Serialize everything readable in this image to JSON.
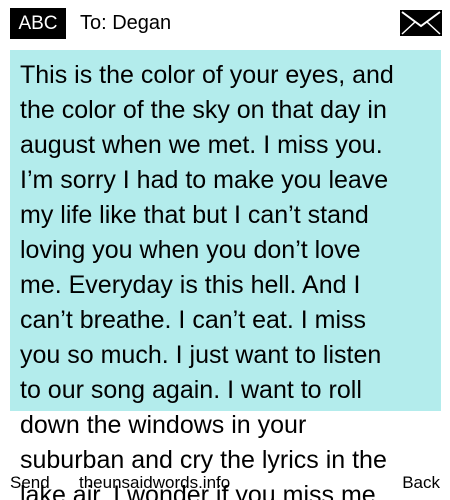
{
  "header": {
    "input_mode": "ABC",
    "recipient": "To: Degan",
    "icon": "envelope-icon"
  },
  "message": {
    "background_color": "#b3ecec",
    "text": "This is the color of your eyes, and\nthe color of the sky on that day in\naugust when we met. I miss you.\nI’m sorry I had to make you leave\nmy life like that but I can’t stand\nloving you when you don’t love\nme. Everyday is this hell. And I\ncan’t breathe. I can’t eat. I miss\nyou so much. I just want to listen\nto our song again. I want to roll\ndown the windows in your\nsuburban and cry the lyrics in the\nlake air. I wonder if you miss me"
  },
  "footer": {
    "left_softkey": "Send",
    "center_text": "theunsaidwords.info",
    "right_softkey": "Back"
  }
}
